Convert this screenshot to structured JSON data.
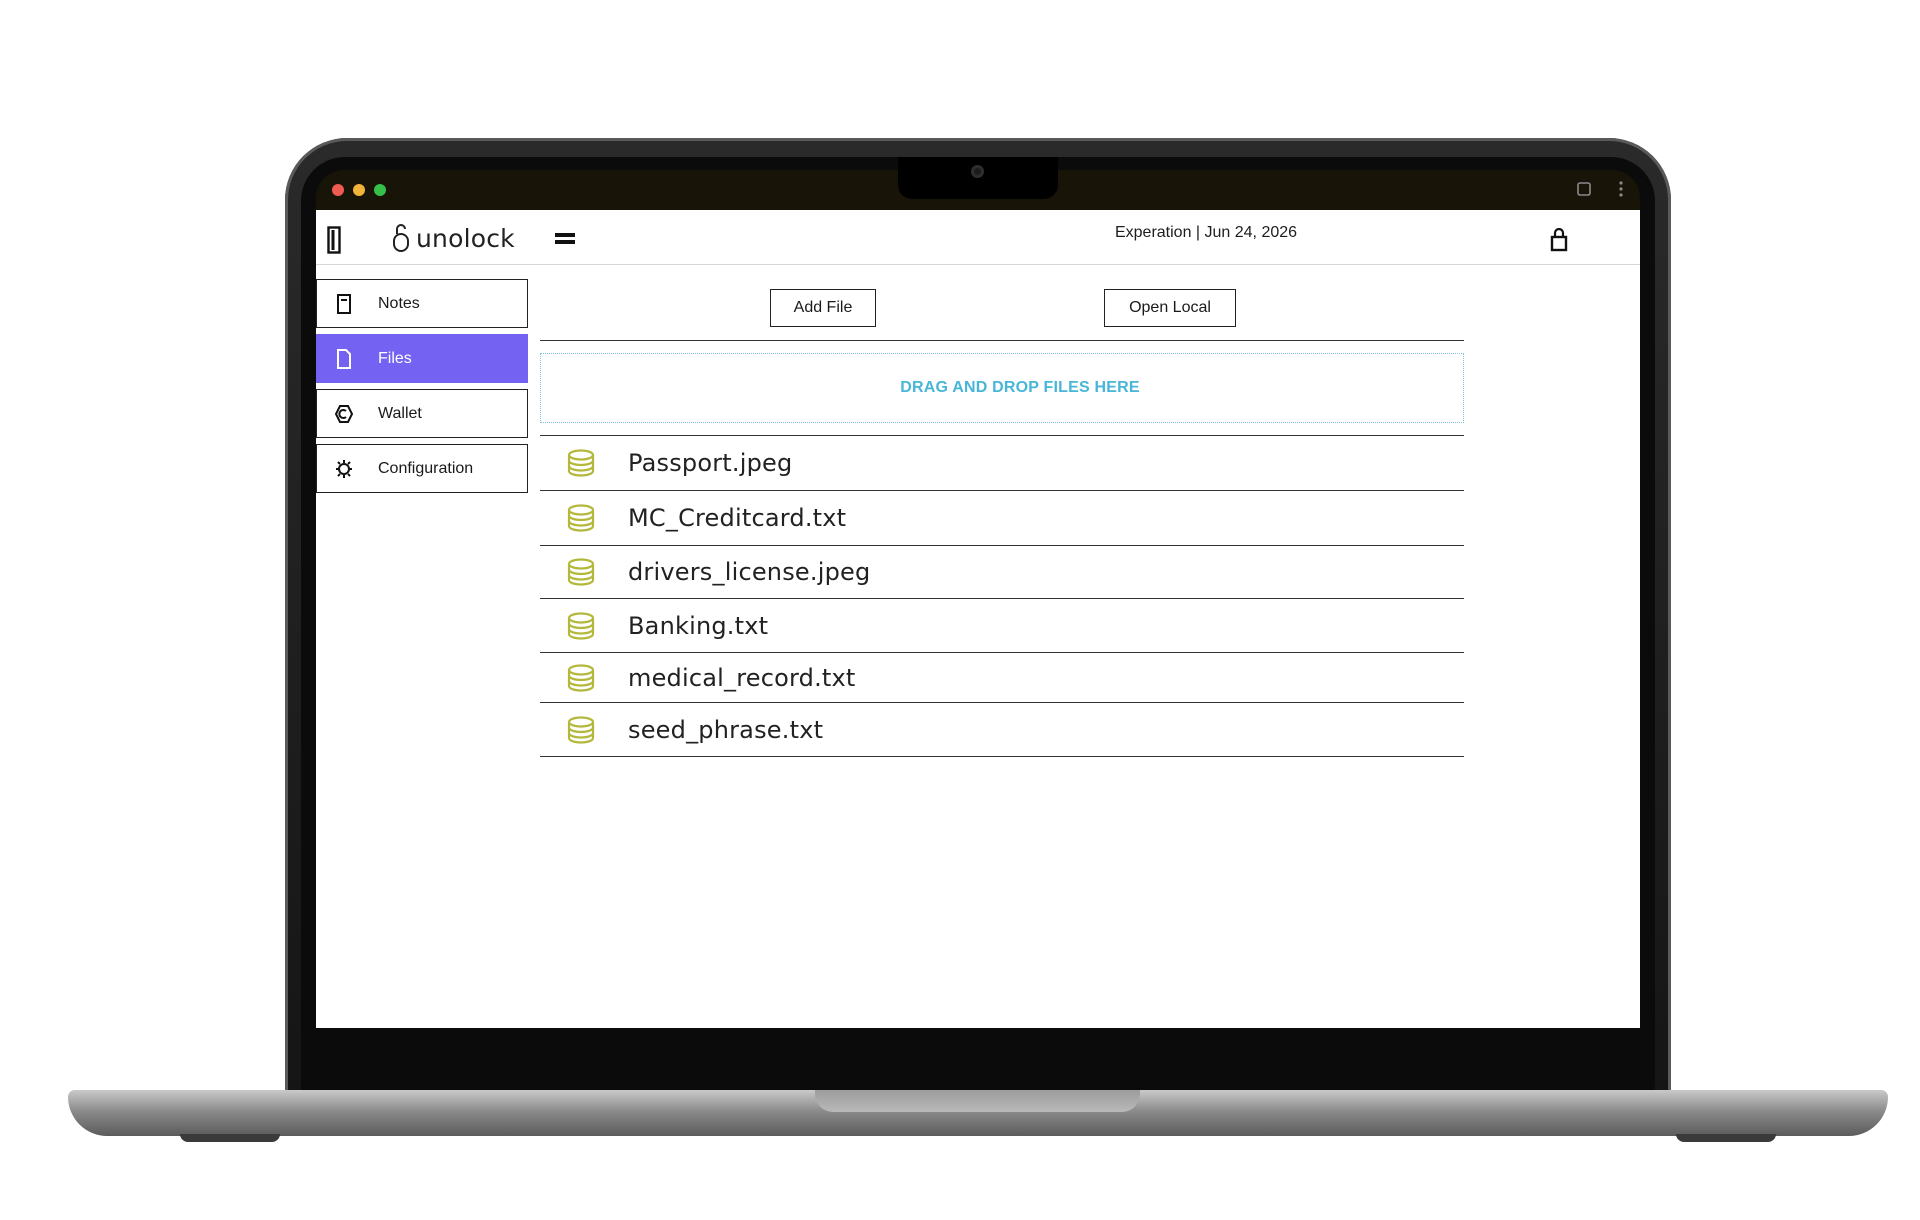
{
  "app": {
    "logo_text": "unolock",
    "expiration": "Experation | Jun 24, 2026"
  },
  "sidebar": {
    "items": [
      {
        "label": "Notes",
        "icon": "note-icon",
        "active": false
      },
      {
        "label": "Files",
        "icon": "file-icon",
        "active": true
      },
      {
        "label": "Wallet",
        "icon": "wallet-icon",
        "active": false
      },
      {
        "label": "Configuration",
        "icon": "gear-icon",
        "active": false
      }
    ]
  },
  "toolbar": {
    "add_file_label": "Add File",
    "open_local_label": "Open Local"
  },
  "dropzone": {
    "text": "DRAG AND DROP FILES HERE"
  },
  "files": [
    {
      "name": "Passport.jpeg",
      "icon": "database-icon"
    },
    {
      "name": "MC_Creditcard.txt",
      "icon": "database-icon"
    },
    {
      "name": "drivers_license.jpeg",
      "icon": "database-icon"
    },
    {
      "name": "Banking.txt",
      "icon": "database-icon"
    },
    {
      "name": "medical_record.txt",
      "icon": "database-icon"
    },
    {
      "name": "seed_phrase.txt",
      "icon": "database-icon"
    }
  ],
  "colors": {
    "accent": "#7462f2",
    "dropzone_text": "#48b6d8",
    "file_icon": "#b3b83a"
  }
}
